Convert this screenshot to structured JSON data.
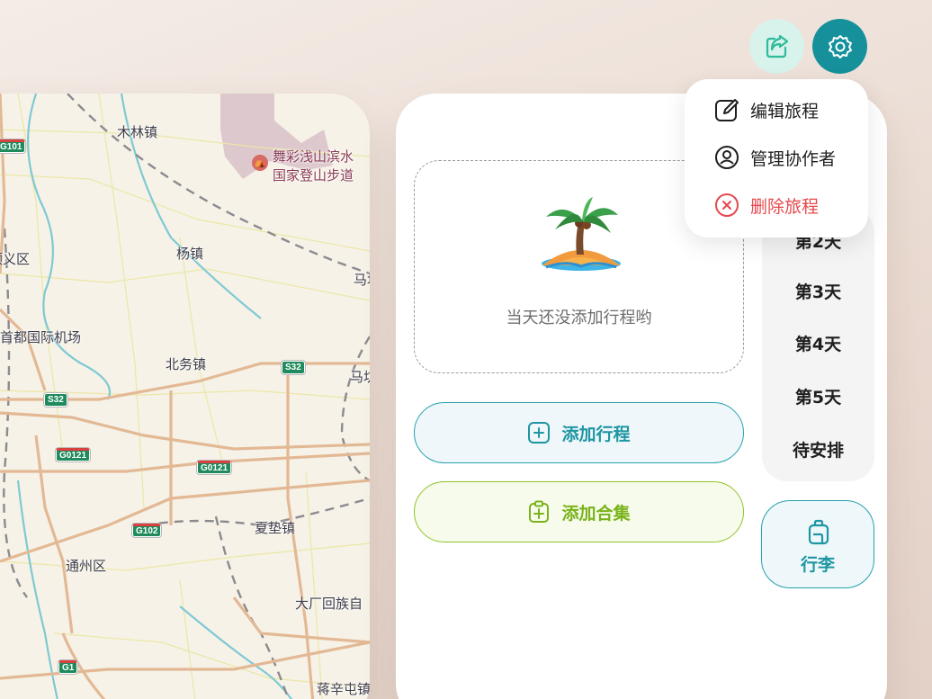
{
  "map": {
    "place_labels": [
      {
        "id": "mulin",
        "text": "木林镇"
      },
      {
        "id": "shunyi",
        "text": "顺义区"
      },
      {
        "id": "yangzhen",
        "text": "杨镇"
      },
      {
        "id": "airport",
        "text": "京首都国际机场"
      },
      {
        "id": "beiwu",
        "text": "北务镇"
      },
      {
        "id": "xiadian",
        "text": "夏垫镇"
      },
      {
        "id": "tongzhou",
        "text": "通州区"
      },
      {
        "id": "dachang",
        "text": "大厂回族自"
      },
      {
        "id": "jiangxin",
        "text": "蒋辛屯镇"
      },
      {
        "id": "ma1",
        "text": "马坊"
      },
      {
        "id": "ma2",
        "text": "马坊"
      }
    ],
    "poi": {
      "name_line1": "舞彩浅山滨水",
      "name_line2": "国家登山步道",
      "icon": "hiking-poi-icon"
    },
    "road_shields": [
      {
        "id": "g101",
        "text": "G101"
      },
      {
        "id": "s32a",
        "text": "S32"
      },
      {
        "id": "s32b",
        "text": "S32"
      },
      {
        "id": "g0121a",
        "text": "G0121"
      },
      {
        "id": "g0121b",
        "text": "G0121"
      },
      {
        "id": "g102",
        "text": "G102"
      },
      {
        "id": "g1",
        "text": "G1"
      }
    ]
  },
  "toolbar": {
    "share_icon": "share-icon",
    "settings_icon": "gear-icon",
    "accent_color": "#16919b"
  },
  "menu": {
    "items": [
      {
        "label": "编辑旅程",
        "icon": "edit-icon"
      },
      {
        "label": "管理协作者",
        "icon": "collaborator-icon"
      },
      {
        "label": "删除旅程",
        "icon": "delete-circle-icon",
        "danger": true
      }
    ],
    "danger_color": "#e5484d"
  },
  "itinerary": {
    "empty_state": {
      "text": "当天还没添加行程哟",
      "icon": "palm-island-icon"
    },
    "add_plan_label": "添加行程",
    "add_collection_label": "添加合集"
  },
  "days": {
    "items": [
      "第2天",
      "第3天",
      "第4天",
      "第5天",
      "待安排"
    ]
  },
  "luggage": {
    "label": "行李",
    "icon": "luggage-icon"
  }
}
